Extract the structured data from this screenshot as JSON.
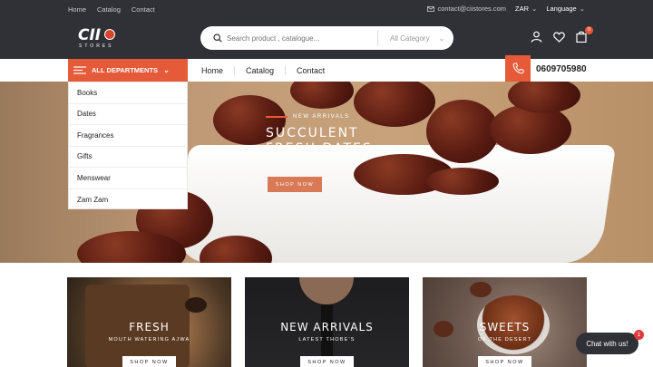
{
  "topbar": {
    "links": [
      "Home",
      "Catalog",
      "Contact"
    ],
    "email": "contact@ciistores.com",
    "currency": "ZAR",
    "language": "Language"
  },
  "header": {
    "logo_main": "CII",
    "logo_sub": "STORES",
    "search_placeholder": "Search product , catalogue...",
    "category_label": "All Category",
    "cart_count": "0"
  },
  "nav": {
    "departments_label": "ALL DEPARTMENTS",
    "links": [
      "Home",
      "Catalog",
      "Contact"
    ],
    "phone": "0609705980"
  },
  "departments": [
    "Books",
    "Dates",
    "Fragrances",
    "Gifts",
    "Menswear",
    "Zam Zam"
  ],
  "hero": {
    "kicker": "NEW ARRIVALS",
    "title_line1": "SUCCULENT",
    "title_line2": "FRESH DATES",
    "button": "SHOP NOW"
  },
  "cards": [
    {
      "title": "FRESH",
      "subtitle": "MOUTH WATERING AJWA",
      "button": "SHOP NOW"
    },
    {
      "title": "NEW ARRIVALS",
      "subtitle": "LATEST THOBE'S",
      "button": "SHOP NOW"
    },
    {
      "title": "SWEETS",
      "subtitle": "OF THE DESERT",
      "button": "SHOP NOW"
    }
  ],
  "chat": {
    "label": "Chat with us!",
    "badge": "1"
  },
  "colors": {
    "accent": "#e55a38",
    "dark": "#2f3136"
  }
}
